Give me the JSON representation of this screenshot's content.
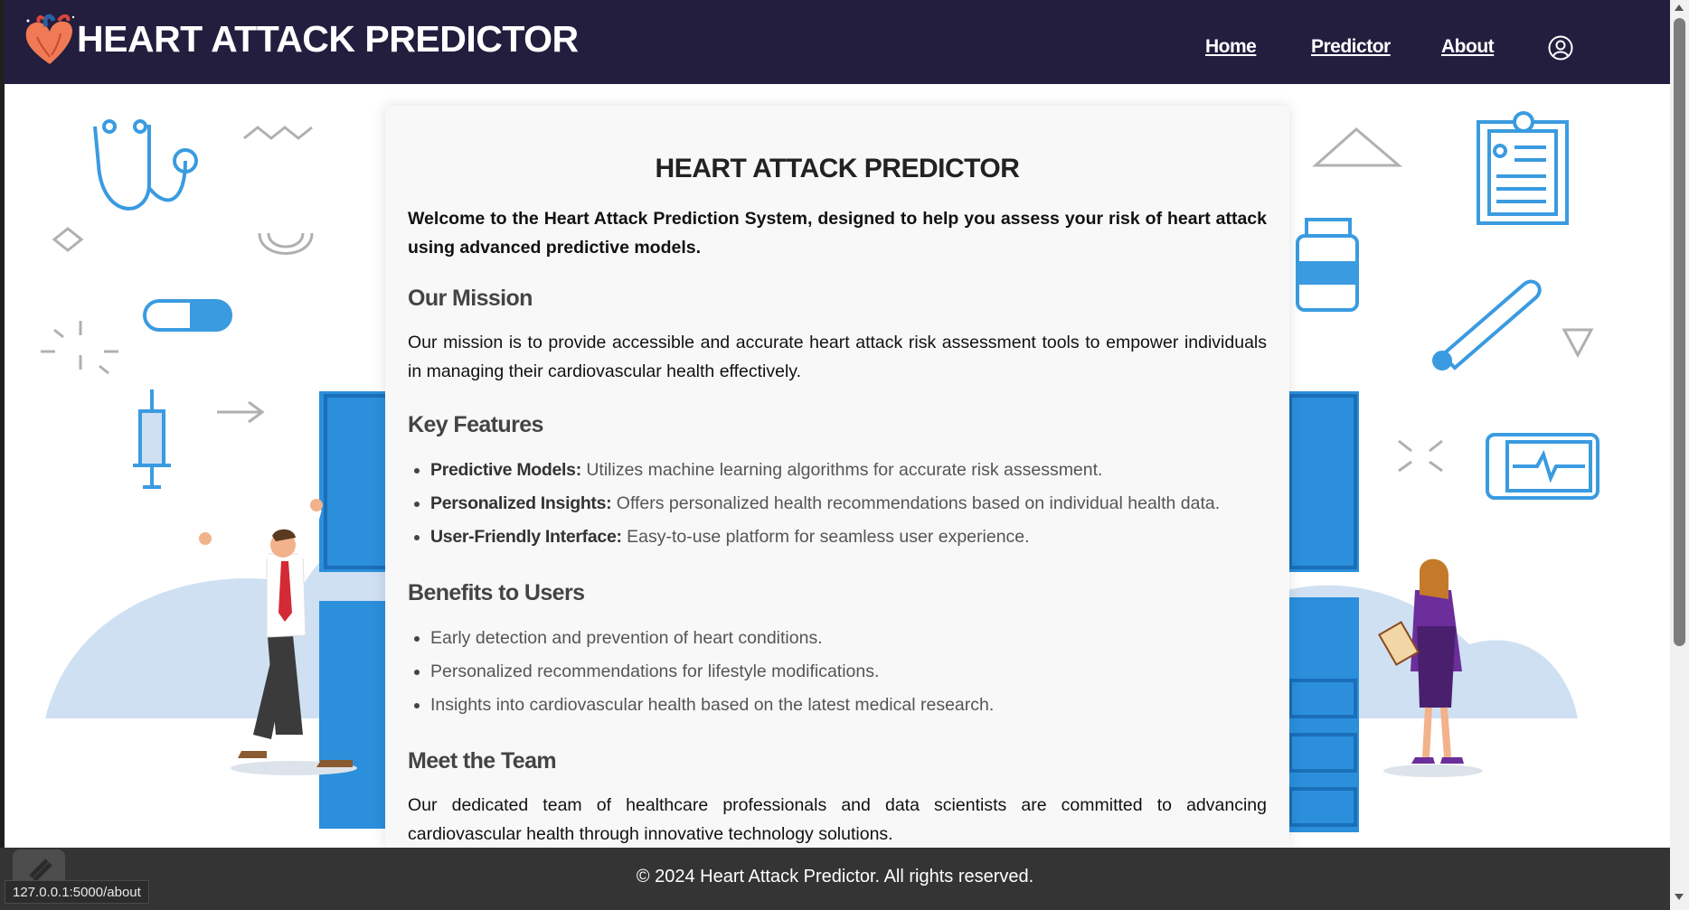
{
  "navbar": {
    "brand_title": "HEART ATTACK PREDICTOR",
    "links": {
      "home": "Home",
      "predictor": "Predictor",
      "about": "About"
    },
    "user_icon": "user-circle-icon"
  },
  "card": {
    "title": "HEART ATTACK PREDICTOR",
    "intro": "Welcome to the Heart Attack Prediction System, designed to help you assess your risk of heart attack using advanced predictive models.",
    "mission": {
      "heading": "Our Mission",
      "text": "Our mission is to provide accessible and accurate heart attack risk assessment tools to empower individuals in managing their cardiovascular health effectively."
    },
    "features": {
      "heading": "Key Features",
      "items": [
        {
          "label": "Predictive Models:",
          "text": " Utilizes machine learning algorithms for accurate risk assessment."
        },
        {
          "label": "Personalized Insights:",
          "text": " Offers personalized health recommendations based on individual health data."
        },
        {
          "label": "User-Friendly Interface:",
          "text": " Easy-to-use platform for seamless user experience."
        }
      ]
    },
    "benefits": {
      "heading": "Benefits to Users",
      "items": [
        "Early detection and prevention of heart conditions.",
        "Personalized recommendations for lifestyle modifications.",
        "Insights into cardiovascular health based on the latest medical research."
      ]
    },
    "team": {
      "heading": "Meet the Team",
      "text": "Our dedicated team of healthcare professionals and data scientists are committed to advancing cardiovascular health through innovative technology solutions."
    }
  },
  "footer": {
    "text": "© 2024 Heart Attack Predictor. All rights reserved."
  },
  "status_bar": {
    "url": "127.0.0.1:5000/about"
  },
  "colors": {
    "navbar": "#231d3e",
    "footer": "#343434",
    "card": "#f8f8f8",
    "illustration_blue": "#2b8fdc"
  }
}
